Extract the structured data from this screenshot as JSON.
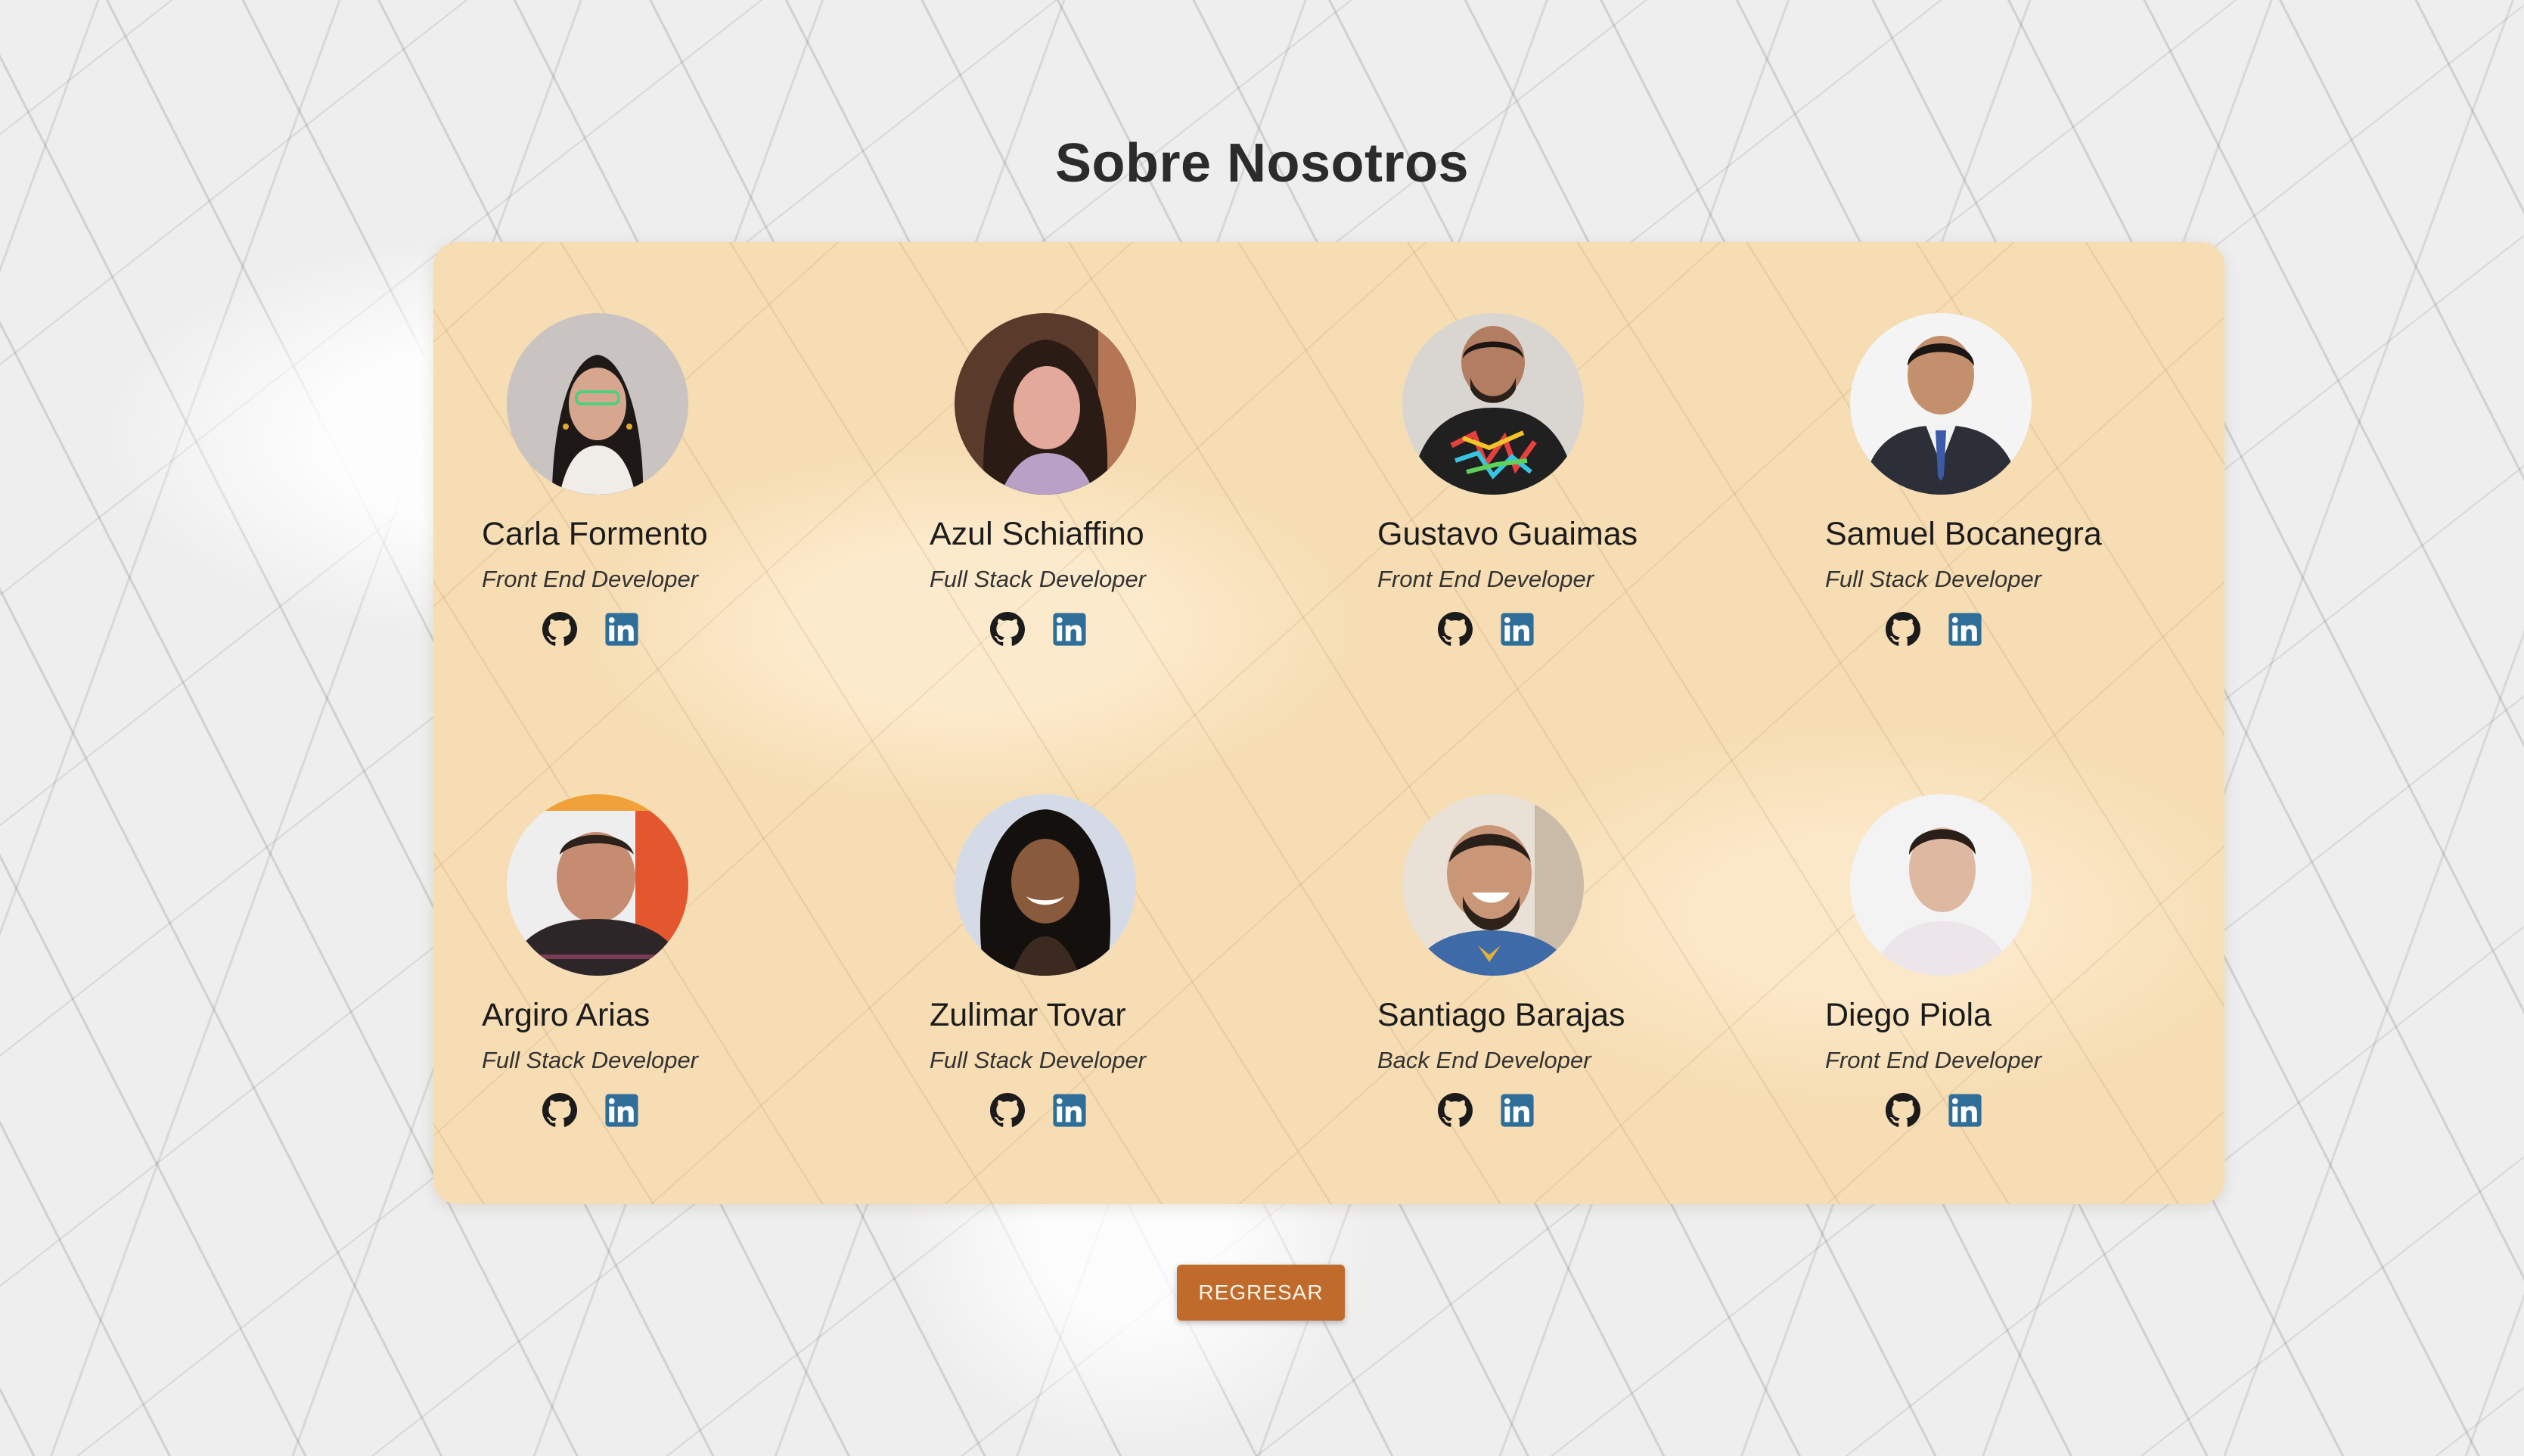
{
  "page": {
    "title": "Sobre Nosotros",
    "back_button_label": "REGRESAR"
  },
  "colors": {
    "panel_background": "#f6ddb3",
    "button_background": "#c06a2c",
    "linkedin_blue": "#2f6e99",
    "github_dark": "#1b1b1b"
  },
  "members": [
    {
      "name": "Carla Formento",
      "role": "Front End Developer",
      "icons": [
        "github-icon",
        "linkedin-icon"
      ]
    },
    {
      "name": "Azul Schiaffino",
      "role": "Full Stack Developer",
      "icons": [
        "github-icon",
        "linkedin-icon"
      ]
    },
    {
      "name": "Gustavo Guaimas",
      "role": "Front End Developer",
      "icons": [
        "github-icon",
        "linkedin-icon"
      ]
    },
    {
      "name": "Samuel Bocanegra",
      "role": "Full Stack Developer",
      "icons": [
        "github-icon",
        "linkedin-icon"
      ]
    },
    {
      "name": "Argiro Arias",
      "role": "Full Stack Developer",
      "icons": [
        "github-icon",
        "linkedin-icon"
      ]
    },
    {
      "name": "Zulimar Tovar",
      "role": "Full Stack Developer",
      "icons": [
        "github-icon",
        "linkedin-icon"
      ]
    },
    {
      "name": "Santiago Barajas",
      "role": "Back End Developer",
      "icons": [
        "github-icon",
        "linkedin-icon"
      ]
    },
    {
      "name": "Diego Piola",
      "role": "Front End Developer",
      "icons": [
        "github-icon",
        "linkedin-icon"
      ]
    }
  ]
}
